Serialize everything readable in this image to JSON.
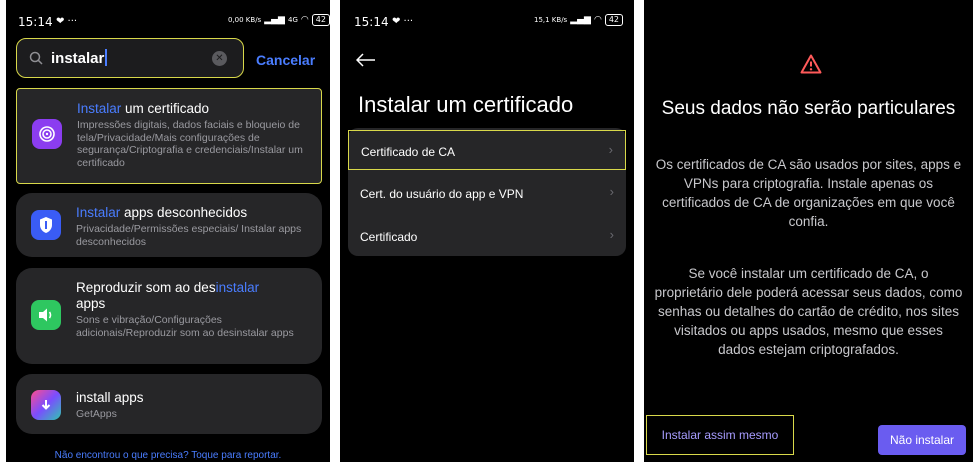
{
  "screen1": {
    "status": {
      "time": "15:14",
      "icons_left": "❤ ···",
      "net_speed": "0,00 KB/s",
      "signal": "4G",
      "battery": "42"
    },
    "search": {
      "query": "instalar",
      "clear_icon": "clear-icon",
      "cancel_label": "Cancelar"
    },
    "results": [
      {
        "title_match": "Instalar",
        "title_rest": " um certificado",
        "subtitle": "Impressões digitais, dados faciais e bloqueio de tela/Privacidade/Mais configurações de segurança/Criptografia e credenciais/Instalar um certificado",
        "icon": "fingerprint-icon",
        "icon_color": "#8b3df0"
      },
      {
        "title_match": "Instalar",
        "title_rest": " apps desconhecidos",
        "subtitle": "Privacidade/Permissões especiais/ Instalar apps desconhecidos",
        "icon": "shield-icon",
        "icon_color": "#3a5cf5"
      },
      {
        "title_pre": "Reproduzir som ao des",
        "title_match": "instalar",
        "title_post": "apps",
        "subtitle": "Sons e vibração/Configurações adicionais/Reproduzir som ao desinstalar apps",
        "icon": "speaker-icon",
        "icon_color": "#2ec760"
      },
      {
        "title": "install apps",
        "subtitle": "GetApps",
        "icon": "getapps-icon"
      }
    ],
    "footer": "Não encontrou o que precisa? Toque para reportar."
  },
  "screen2": {
    "status": {
      "time": "15:14",
      "net_speed": "15,1 KB/s",
      "battery": "42"
    },
    "title": "Instalar um certificado",
    "items": [
      "Certificado de CA",
      "Cert. do usuário do app e VPN",
      "Certificado"
    ]
  },
  "screen3": {
    "title": "Seus dados não serão particulares",
    "para1": "Os certificados de CA são usados por sites, apps e VPNs para criptografia. Instale apenas os certificados de CA de organizações em que você confia.",
    "para2": "Se você instalar um certificado de CA, o proprietário dele poderá acessar seus dados, como senhas ou detalhes do cartão de crédito, nos sites visitados ou apps usados, mesmo que esses dados estejam criptografados.",
    "install_anyway": "Instalar assim mesmo",
    "dont_install": "Não instalar",
    "warning_color": "#ff5a5a"
  }
}
